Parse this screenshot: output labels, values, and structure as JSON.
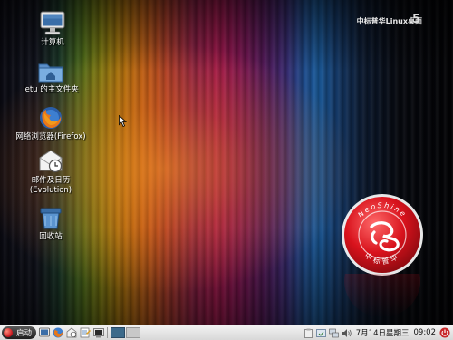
{
  "desktop": {
    "brand": {
      "text": "中标普华Linux桌面",
      "version": "5"
    },
    "logo": {
      "top_text": "NeoShine",
      "bottom_text": "中标普华"
    },
    "icons": [
      {
        "label": "计算机",
        "icon": "computer-icon"
      },
      {
        "label": "letu 的主文件夹",
        "icon": "home-folder-icon"
      },
      {
        "label": "网络浏览器(Firefox)",
        "icon": "firefox-icon"
      },
      {
        "label_line1": "邮件及日历",
        "label_line2": "(Evolution)",
        "icon": "mail-calendar-icon"
      },
      {
        "label": "回收站",
        "icon": "trash-icon"
      }
    ]
  },
  "taskbar": {
    "start_label": "启动",
    "date": "7月14日星期三",
    "time": "09:02"
  },
  "colors": {
    "logo_red": "#d8121c",
    "taskbar_bg": "#e4e4e4"
  }
}
